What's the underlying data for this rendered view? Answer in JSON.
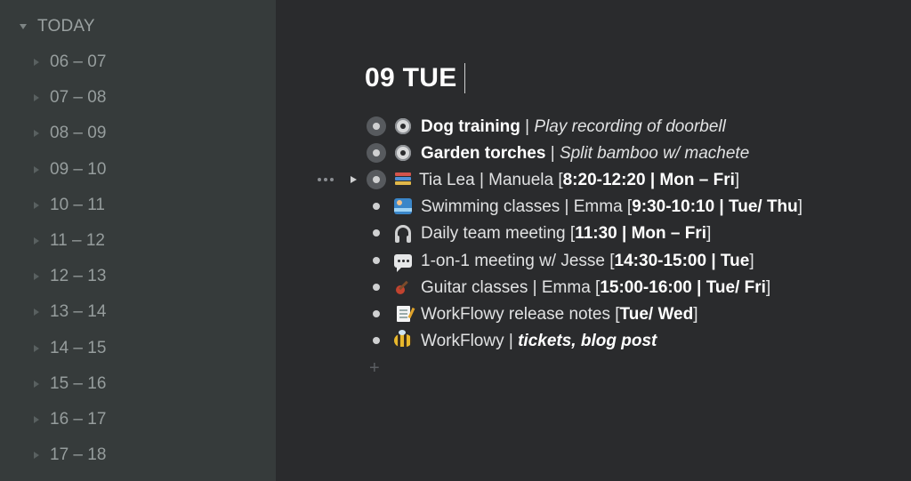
{
  "sidebar": {
    "header": "TODAY",
    "items": [
      "06 – 07",
      "07 – 08",
      "08 – 09",
      "09 – 10",
      "10 – 11",
      "11 – 12",
      "12 – 13",
      "13 – 14",
      "14 – 15",
      "15 – 16",
      "16 – 17",
      "17 – 18"
    ]
  },
  "main": {
    "title": "09 TUE",
    "rows": [
      {
        "icon": "gear-icon",
        "parts": [
          "Dog training",
          " | ",
          "Play recording of doorbell"
        ]
      },
      {
        "icon": "gear-icon",
        "parts": [
          "Garden torches",
          " | ",
          "Split bamboo w/ machete"
        ]
      },
      {
        "icon": "books-icon",
        "parts": [
          "Tia Lea | Manuela [",
          "8:20-12:20 | Mon – Fri",
          "]"
        ]
      },
      {
        "icon": "swimmer-icon",
        "parts": [
          "Swimming classes | Emma [",
          "9:30-10:10 | Tue/ Thu",
          "]"
        ]
      },
      {
        "icon": "headphones-icon",
        "parts": [
          "Daily team meeting [",
          "11:30 | Mon – Fri",
          "]"
        ]
      },
      {
        "icon": "speech-bubble-icon",
        "parts": [
          "1-on-1 meeting w/ Jesse  [",
          "14:30-15:00 | Tue",
          "]"
        ]
      },
      {
        "icon": "guitar-icon",
        "parts": [
          "Guitar classes | Emma  [",
          "15:00-16:00 | Tue/ Fri",
          "]"
        ]
      },
      {
        "icon": "memo-icon",
        "parts": [
          "WorkFlowy release notes [",
          "Tue/ Wed",
          "]"
        ]
      },
      {
        "icon": "bee-icon",
        "parts": [
          "WorkFlowy | ",
          "tickets, blog post"
        ]
      }
    ],
    "add_label": "+"
  }
}
